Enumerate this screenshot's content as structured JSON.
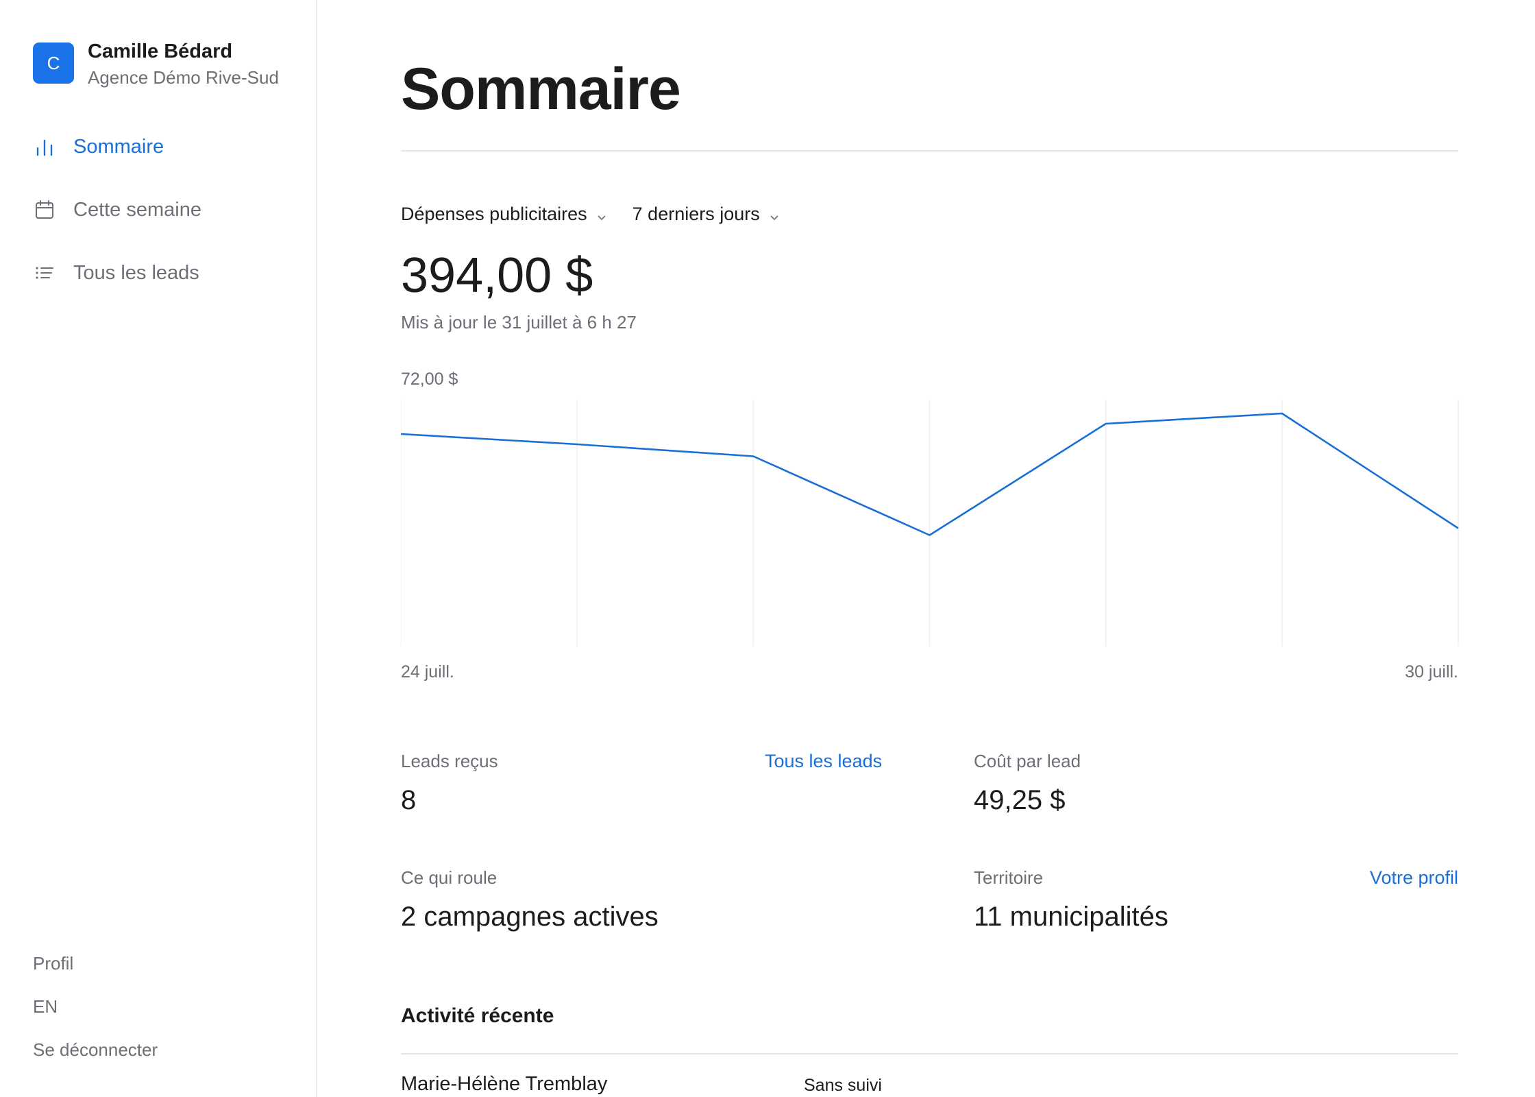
{
  "account": {
    "avatar_letter": "C",
    "name": "Camille Bédard",
    "agency": "Agence Démo Rive-Sud",
    "avatar_color": "#1a73e8"
  },
  "nav": {
    "items": [
      {
        "label": "Sommaire",
        "icon": "bar-chart-icon",
        "active": true
      },
      {
        "label": "Cette semaine",
        "icon": "calendar-icon",
        "active": false
      },
      {
        "label": "Tous les leads",
        "icon": "list-icon",
        "active": false
      }
    ]
  },
  "footer_links": {
    "profile": "Profil",
    "language": "EN",
    "logout": "Se déconnecter"
  },
  "page": {
    "title": "Sommaire"
  },
  "filters": {
    "metric": "Dépenses publicitaires",
    "period": "7 derniers jours"
  },
  "summary": {
    "total": "394,00 $",
    "updated": "Mis à jour le 31 juillet à 6 h 27"
  },
  "chart_data": {
    "type": "line",
    "x": [
      "24 juill.",
      "25 juill.",
      "26 juill.",
      "27 juill.",
      "28 juill.",
      "29 juill.",
      "30 juill."
    ],
    "x_tick_labels": [
      "24 juill.",
      "30 juill."
    ],
    "y_max_label": "72,00 $",
    "ylim": [
      0,
      72
    ],
    "series": [
      {
        "values": [
          62,
          59,
          55.5,
          32.5,
          65,
          68,
          34.5
        ],
        "color": "#1a6fd6"
      }
    ],
    "grid": "vertical"
  },
  "stats": {
    "leads_label": "Leads reçus",
    "leads_value": "8",
    "leads_link": "Tous les leads",
    "cpl_label": "Coût par lead",
    "cpl_value": "49,25 $",
    "running_label": "Ce qui roule",
    "running_value": "2 campagnes actives",
    "territory_label": "Territoire",
    "territory_value": "11 municipalités",
    "profile_link": "Votre profil"
  },
  "activity": {
    "title": "Activité récente",
    "items": [
      {
        "name": "Marie-Hélène Tremblay",
        "status": "Sans suivi"
      }
    ]
  }
}
